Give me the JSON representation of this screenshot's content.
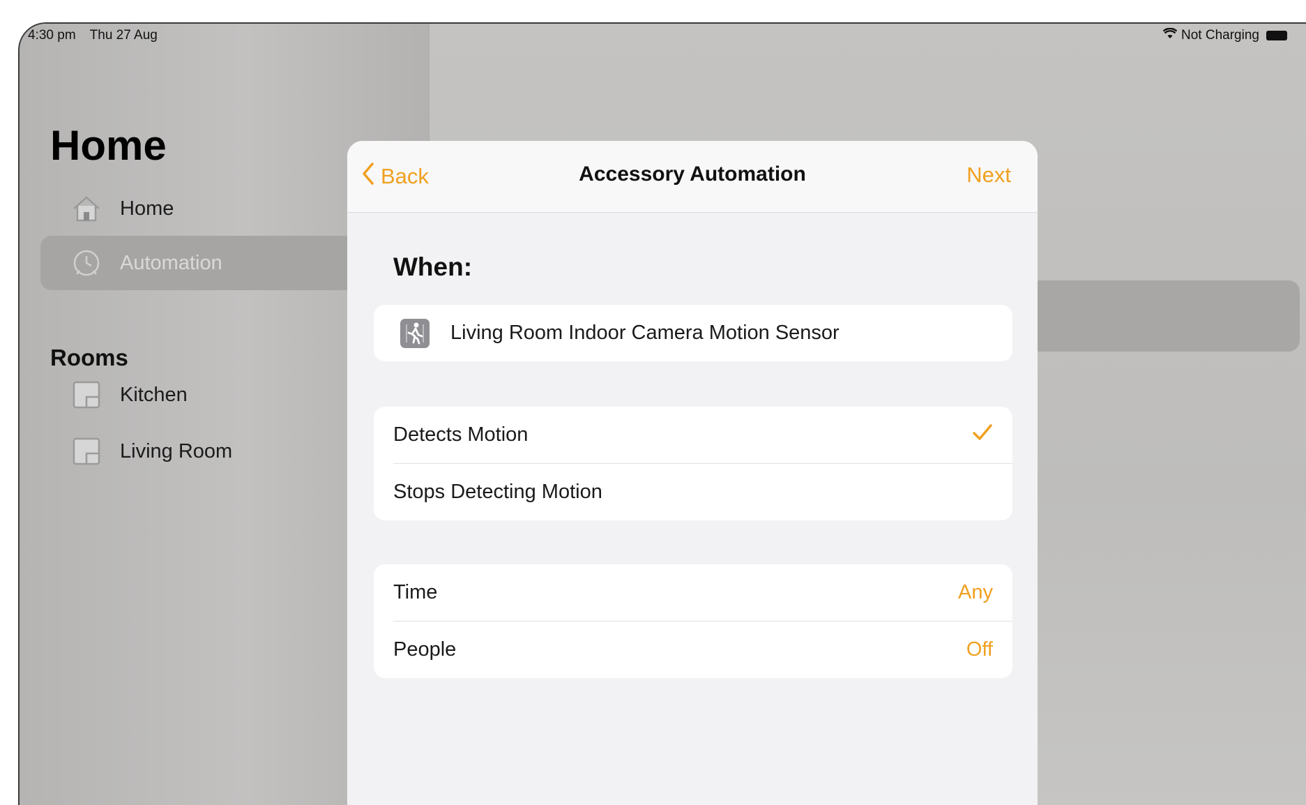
{
  "status_bar": {
    "time": "4:30 pm",
    "date": "Thu 27 Aug",
    "charging": "Not Charging"
  },
  "sidebar": {
    "title": "Home",
    "items": [
      {
        "label": "Home",
        "icon": "house-icon"
      },
      {
        "label": "Automation",
        "icon": "clock-icon",
        "selected": true
      }
    ],
    "rooms_title": "Rooms",
    "rooms": [
      {
        "label": "Kitchen",
        "icon": "room-icon"
      },
      {
        "label": "Living Room",
        "icon": "room-icon"
      }
    ]
  },
  "modal": {
    "back_label": "Back",
    "title": "Accessory Automation",
    "next_label": "Next",
    "when_label": "When:",
    "accessory": "Living Room Indoor Camera Motion Sensor",
    "triggers": [
      {
        "label": "Detects Motion",
        "checked": true
      },
      {
        "label": "Stops Detecting Motion",
        "checked": false
      }
    ],
    "conditions": [
      {
        "label": "Time",
        "value": "Any"
      },
      {
        "label": "People",
        "value": "Off"
      }
    ]
  },
  "colors": {
    "accent": "#f0a020",
    "dimmed_background": "#bdbcbb"
  }
}
